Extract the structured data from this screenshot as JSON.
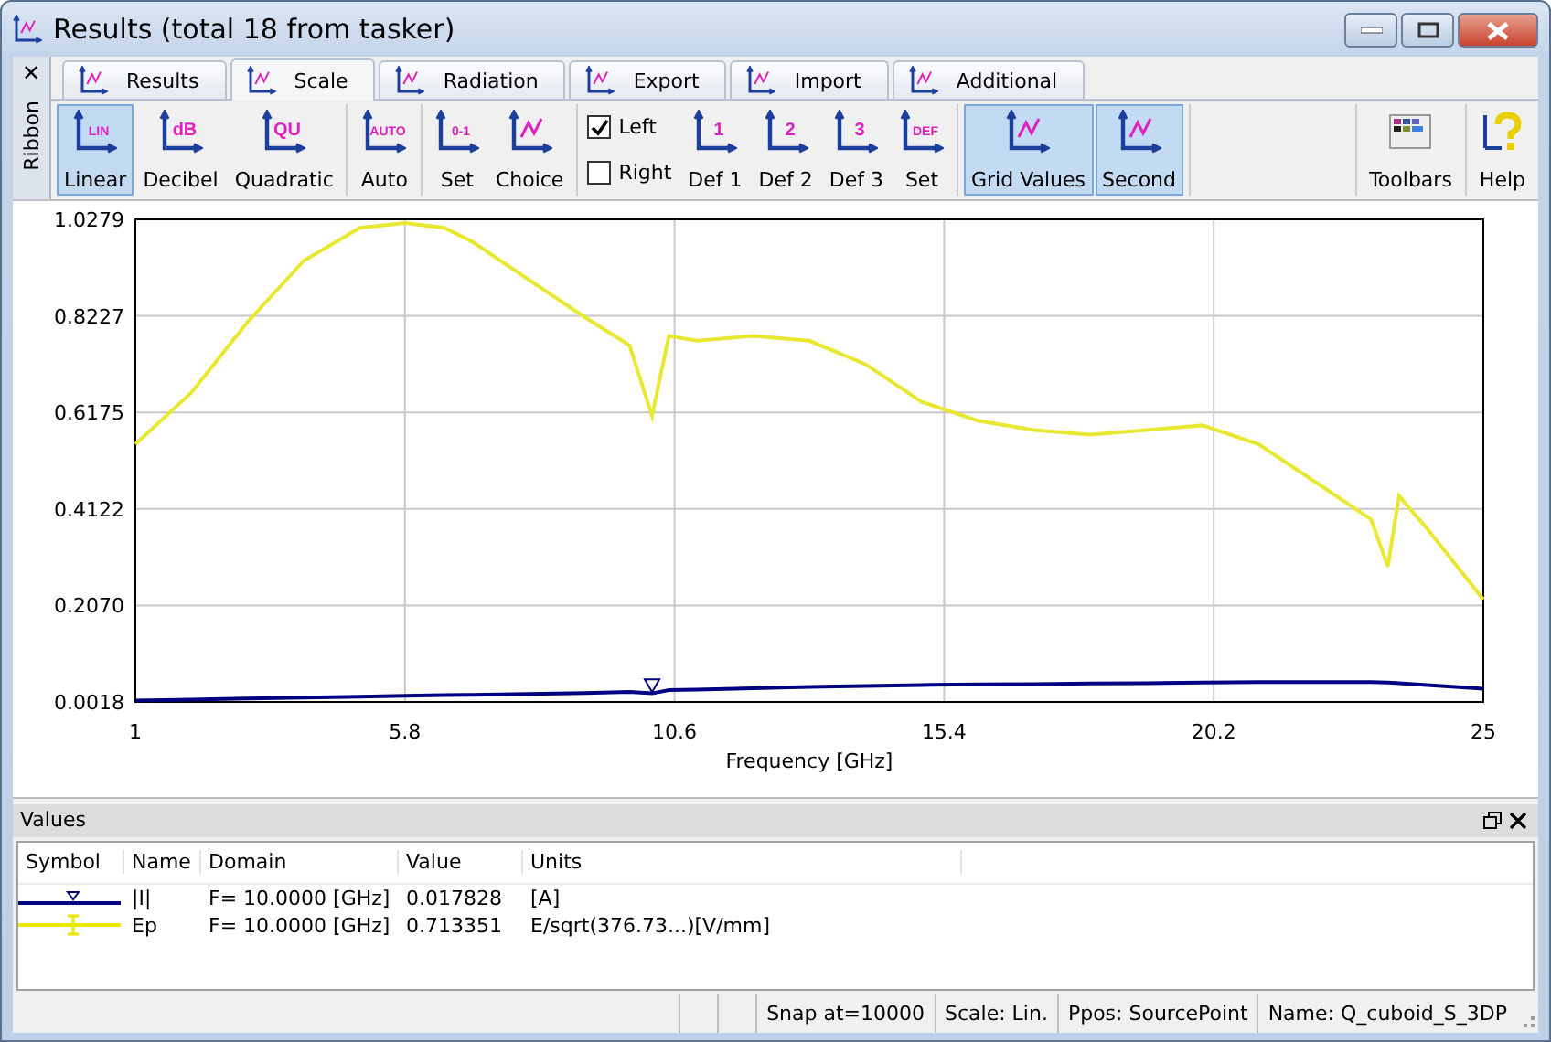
{
  "window": {
    "title": "Results (total 18 from tasker)"
  },
  "ribbon_side": {
    "label": "Ribbon",
    "close": "✕"
  },
  "tabs": [
    {
      "label": "Results",
      "selected": false
    },
    {
      "label": "Scale",
      "selected": true
    },
    {
      "label": "Radiation",
      "selected": false
    },
    {
      "label": "Export",
      "selected": false
    },
    {
      "label": "Import",
      "selected": false
    },
    {
      "label": "Additional",
      "selected": false
    }
  ],
  "toolbar_groups": [
    [
      {
        "kind": "button",
        "label": "Linear",
        "icon_text": "LIN",
        "selected": true
      },
      {
        "kind": "button",
        "label": "Decibel",
        "icon_text": "dB",
        "selected": false
      },
      {
        "kind": "button",
        "label": "Quadratic",
        "icon_text": "QU",
        "selected": false
      }
    ],
    [
      {
        "kind": "button",
        "label": "Auto",
        "icon_text": "AUTO",
        "selected": false
      }
    ],
    [
      {
        "kind": "button",
        "label": "Set",
        "icon_text": "0-1",
        "selected": false
      },
      {
        "kind": "button",
        "label": "Choice",
        "selected": false
      }
    ],
    [
      {
        "kind": "checkbox",
        "label": "Left",
        "checked": true
      },
      {
        "kind": "checkbox",
        "label": "Right",
        "checked": false
      },
      {
        "kind": "button",
        "label": "Def 1",
        "icon_text": "1",
        "selected": false
      },
      {
        "kind": "button",
        "label": "Def 2",
        "icon_text": "2",
        "selected": false
      },
      {
        "kind": "button",
        "label": "Def 3",
        "icon_text": "3",
        "selected": false
      },
      {
        "kind": "button",
        "label": "Set",
        "icon_text": "DEF",
        "selected": false
      }
    ],
    [
      {
        "kind": "button",
        "label": "Grid Values",
        "selected": true
      },
      {
        "kind": "button",
        "label": "Second",
        "selected": true
      }
    ]
  ],
  "right_tools": [
    {
      "label": "Toolbars"
    },
    {
      "label": "Help"
    }
  ],
  "chart": {
    "chart_data": {
      "type": "line",
      "xlabel": "Frequency [GHz]",
      "x": [
        1,
        2,
        3,
        4,
        5,
        5.8,
        6.5,
        7,
        8,
        9,
        9.8,
        10.2,
        10.5,
        11,
        12,
        13,
        14,
        15,
        16,
        17,
        18,
        19,
        20,
        21,
        22,
        23,
        23.3,
        23.5,
        24,
        25
      ],
      "series": [
        {
          "color": "#000080",
          "values": [
            0.005,
            0.007,
            0.009,
            0.011,
            0.013,
            0.015,
            0.016,
            0.017,
            0.019,
            0.021,
            0.023,
            0.02,
            0.027,
            0.028,
            0.031,
            0.034,
            0.036,
            0.038,
            0.039,
            0.04,
            0.041,
            0.042,
            0.043,
            0.044,
            0.044,
            0.044,
            0.043,
            0.042,
            0.038,
            0.03
          ]
        },
        {
          "color": "#e8e832",
          "values": [
            0.55,
            0.66,
            0.81,
            0.94,
            1.01,
            1.02,
            1.01,
            0.98,
            0.9,
            0.82,
            0.76,
            0.61,
            0.78,
            0.77,
            0.78,
            0.77,
            0.72,
            0.64,
            0.6,
            0.58,
            0.57,
            0.58,
            0.59,
            0.55,
            0.47,
            0.39,
            0.29,
            0.44,
            0.37,
            0.22
          ]
        }
      ],
      "grid": true,
      "xlim": [
        1,
        25
      ],
      "ylim": [
        0.0018,
        1.0279
      ],
      "xticks": [
        {
          "value": 1,
          "label": "1"
        },
        {
          "value": 5.8,
          "label": "5.8"
        },
        {
          "value": 10.6,
          "label": "10.6"
        },
        {
          "value": 15.4,
          "label": "15.4"
        },
        {
          "value": 20.2,
          "label": "20.2"
        },
        {
          "value": 25,
          "label": "25"
        }
      ],
      "yticks": [
        {
          "value": 0.0018,
          "label": "0.0018"
        },
        {
          "value": 0.207,
          "label": "0.2070"
        },
        {
          "value": 0.4122,
          "label": "0.4122"
        },
        {
          "value": 0.6175,
          "label": "0.6175"
        },
        {
          "value": 0.8227,
          "label": "0.8227"
        },
        {
          "value": 1.0279,
          "label": "1.0279"
        }
      ]
    }
  },
  "values_panel": {
    "title": "Values",
    "columns": [
      "Symbol",
      "Name",
      "Domain",
      "Value",
      "Units"
    ],
    "rows": [
      {
        "color": "#000080",
        "kind": "triangle",
        "name": "|I|",
        "domain": "F= 10.0000 [GHz]",
        "value": "0.017828",
        "units": "[A]"
      },
      {
        "color": "#e8e800",
        "kind": "bar",
        "name": "Ep",
        "domain": "F= 10.0000 [GHz]",
        "value": "0.713351",
        "units": "E/sqrt(376.73...)[V/mm]"
      }
    ]
  },
  "status_bar": [
    "Snap at=10000",
    "Scale: Lin.",
    "Ppos: SourcePoint",
    "Name: Q_cuboid_S_3DP"
  ]
}
